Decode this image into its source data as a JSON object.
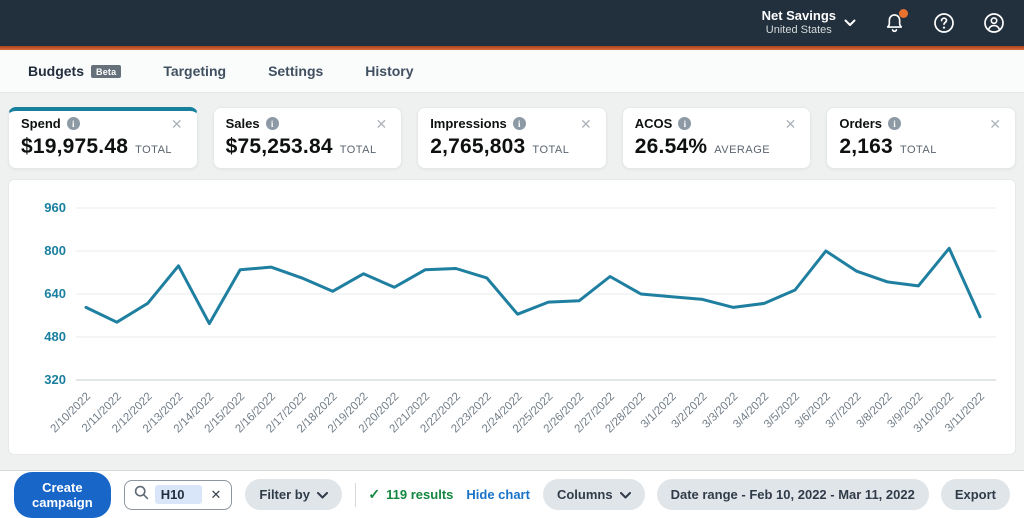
{
  "header": {
    "account_name": "Net Savings",
    "account_region": "United States",
    "icons": [
      "chevron-down",
      "notification-bell-with-dot",
      "help-question-circle",
      "account-person-circle"
    ],
    "bar_color": "#222f3d",
    "accent_color": "#df6a3e"
  },
  "tabs": [
    {
      "label": "Budgets",
      "badge": "Beta",
      "active": true
    },
    {
      "label": "Targeting",
      "active": false
    },
    {
      "label": "Settings",
      "active": false
    },
    {
      "label": "History",
      "active": false
    }
  ],
  "metric_cards": [
    {
      "label": "Spend",
      "value": "$19,975.48",
      "unit": "TOTAL",
      "selected": true,
      "accent": "#17809c"
    },
    {
      "label": "Sales",
      "value": "$75,253.84",
      "unit": "TOTAL",
      "selected": false
    },
    {
      "label": "Impressions",
      "value": "2,765,803",
      "unit": "TOTAL",
      "selected": false
    },
    {
      "label": "ACOS",
      "value": "26.54%",
      "unit": "AVERAGE",
      "selected": false
    },
    {
      "label": "Orders",
      "value": "2,163",
      "unit": "TOTAL",
      "selected": false
    }
  ],
  "chart_data": {
    "type": "line",
    "x": [
      "2/10/2022",
      "2/11/2022",
      "2/12/2022",
      "2/13/2022",
      "2/14/2022",
      "2/15/2022",
      "2/16/2022",
      "2/17/2022",
      "2/18/2022",
      "2/19/2022",
      "2/20/2022",
      "2/21/2022",
      "2/22/2022",
      "2/23/2022",
      "2/24/2022",
      "2/25/2022",
      "2/26/2022",
      "2/27/2022",
      "2/28/2022",
      "3/1/2022",
      "3/2/2022",
      "3/3/2022",
      "3/4/2022",
      "3/5/2022",
      "3/6/2022",
      "3/7/2022",
      "3/8/2022",
      "3/9/2022",
      "3/10/2022",
      "3/11/2022"
    ],
    "values": [
      590,
      535,
      605,
      745,
      530,
      730,
      740,
      700,
      650,
      715,
      665,
      730,
      735,
      700,
      565,
      610,
      615,
      705,
      640,
      630,
      620,
      590,
      605,
      655,
      800,
      725,
      685,
      670,
      810,
      555
    ],
    "ylim": [
      320,
      960
    ],
    "yticks": [
      320,
      480,
      640,
      800,
      960
    ],
    "grid": true,
    "legend": "none",
    "line_color": "#1e7fa0",
    "ytick_color": "#1a7f9f",
    "xtick_color": "#727d87"
  },
  "toolbar": {
    "create_campaign_label": "Create campaign",
    "search": {
      "value": "H10",
      "icon": "magnifier",
      "clear_icon": "x"
    },
    "filter_by_label": "Filter by",
    "results_check_icon": "check",
    "results_text": "119 results",
    "hide_chart_label": "Hide chart",
    "columns_label": "Columns",
    "date_range_label": "Date range - Feb 10, 2022 - Mar 11, 2022",
    "export_label": "Export"
  },
  "colors": {
    "primary_button_blue": "#1766c8",
    "link_blue": "#1a73c9",
    "results_green": "#12873f",
    "selection_highlight": "#d9e6f9"
  }
}
